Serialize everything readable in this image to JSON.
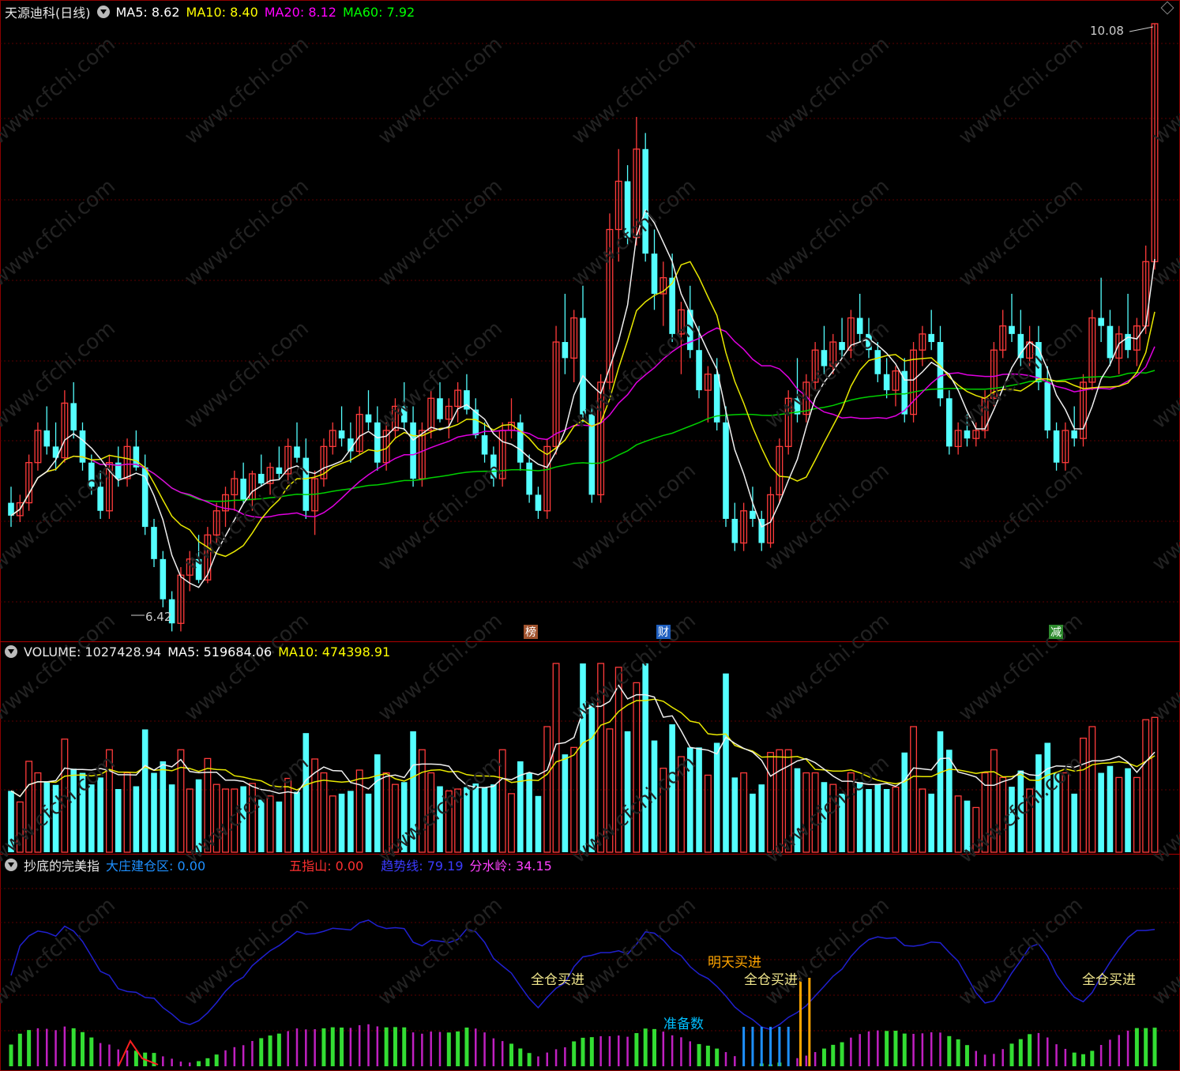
{
  "header": {
    "stock_title": "天源迪科(日线)",
    "ma5_label": "MA5: 8.62",
    "ma10_label": "MA10: 8.40",
    "ma20_label": "MA20: 8.12",
    "ma60_label": "MA60: 7.92",
    "colors": {
      "ma5": "#ffffff",
      "ma10": "#ffff00",
      "ma20": "#ff00ff",
      "ma60": "#00ff00"
    }
  },
  "price_chart": {
    "high_label": "10.08",
    "low_label": "6.42",
    "event_tags": [
      {
        "text": "榜",
        "bg": "#a0522d"
      },
      {
        "text": "财",
        "bg": "#1f5fbf"
      },
      {
        "text": "减",
        "bg": "#2e8b2e"
      }
    ]
  },
  "volume_panel": {
    "volume_label": "VOLUME: 1027428.94",
    "ma5_label": "MA5: 519684.06",
    "ma10_label": "MA10: 474398.91"
  },
  "indicator_panel": {
    "name": "抄底的完美指",
    "dzjc_label": "大庄建仓区: 0.00",
    "wzs_label": "五指山: 0.00",
    "qsx_label": "趋势线: 79.19",
    "fsl_label": "分水岭: 34.15",
    "signals": [
      "全仓买进",
      "准备数",
      "明天买进",
      "全仓买进",
      "全仓买进"
    ]
  },
  "watermark": "www.cfchi.com",
  "chart_data": {
    "type": "candlestick",
    "title": "天源迪科(日线)",
    "price_high": 10.08,
    "price_low": 6.42,
    "ma_latest": {
      "MA5": 8.62,
      "MA10": 8.4,
      "MA20": 8.12,
      "MA60": 7.92
    },
    "volume_latest": {
      "VOLUME": 1027428.94,
      "MA5": 519684.06,
      "MA10": 474398.91
    },
    "indicator_latest": {
      "大庄建仓区": 0.0,
      "五指山": 0.0,
      "趋势线": 79.19,
      "分水岭": 34.15
    },
    "candles_ohlc": [
      [
        7.1,
        7.2,
        6.95,
        7.02
      ],
      [
        7.02,
        7.15,
        6.98,
        7.1
      ],
      [
        7.1,
        7.4,
        7.05,
        7.35
      ],
      [
        7.35,
        7.6,
        7.3,
        7.55
      ],
      [
        7.55,
        7.7,
        7.4,
        7.45
      ],
      [
        7.45,
        7.6,
        7.3,
        7.38
      ],
      [
        7.38,
        7.8,
        7.35,
        7.72
      ],
      [
        7.72,
        7.85,
        7.5,
        7.55
      ],
      [
        7.55,
        7.6,
        7.3,
        7.35
      ],
      [
        7.35,
        7.4,
        7.15,
        7.2
      ],
      [
        7.2,
        7.3,
        7.0,
        7.05
      ],
      [
        7.05,
        7.4,
        7.0,
        7.35
      ],
      [
        7.35,
        7.45,
        7.2,
        7.25
      ],
      [
        7.25,
        7.5,
        7.2,
        7.45
      ],
      [
        7.45,
        7.55,
        7.3,
        7.32
      ],
      [
        7.32,
        7.4,
        6.9,
        6.95
      ],
      [
        6.95,
        7.0,
        6.7,
        6.75
      ],
      [
        6.75,
        6.8,
        6.45,
        6.5
      ],
      [
        6.5,
        6.55,
        6.3,
        6.35
      ],
      [
        6.35,
        6.7,
        6.3,
        6.65
      ],
      [
        6.65,
        6.8,
        6.55,
        6.75
      ],
      [
        6.75,
        6.9,
        6.6,
        6.62
      ],
      [
        6.62,
        6.95,
        6.6,
        6.9
      ],
      [
        6.9,
        7.1,
        6.85,
        7.05
      ],
      [
        7.05,
        7.2,
        6.95,
        7.15
      ],
      [
        7.15,
        7.3,
        7.05,
        7.25
      ],
      [
        7.25,
        7.35,
        7.1,
        7.12
      ],
      [
        7.12,
        7.3,
        7.05,
        7.28
      ],
      [
        7.28,
        7.4,
        7.2,
        7.22
      ],
      [
        7.22,
        7.35,
        7.15,
        7.32
      ],
      [
        7.32,
        7.45,
        7.25,
        7.28
      ],
      [
        7.28,
        7.5,
        7.22,
        7.45
      ],
      [
        7.45,
        7.6,
        7.35,
        7.38
      ],
      [
        7.38,
        7.5,
        7.0,
        7.05
      ],
      [
        7.05,
        7.3,
        6.9,
        7.25
      ],
      [
        7.25,
        7.5,
        7.2,
        7.45
      ],
      [
        7.45,
        7.6,
        7.4,
        7.55
      ],
      [
        7.55,
        7.7,
        7.45,
        7.5
      ],
      [
        7.5,
        7.6,
        7.35,
        7.42
      ],
      [
        7.42,
        7.7,
        7.4,
        7.65
      ],
      [
        7.65,
        7.8,
        7.55,
        7.6
      ],
      [
        7.6,
        7.7,
        7.3,
        7.35
      ],
      [
        7.35,
        7.6,
        7.3,
        7.55
      ],
      [
        7.55,
        7.75,
        7.5,
        7.7
      ],
      [
        7.7,
        7.85,
        7.55,
        7.6
      ],
      [
        7.6,
        7.7,
        7.2,
        7.25
      ],
      [
        7.25,
        7.6,
        7.2,
        7.55
      ],
      [
        7.55,
        7.8,
        7.5,
        7.75
      ],
      [
        7.75,
        7.85,
        7.6,
        7.62
      ],
      [
        7.62,
        7.75,
        7.5,
        7.7
      ],
      [
        7.7,
        7.85,
        7.6,
        7.8
      ],
      [
        7.8,
        7.9,
        7.65,
        7.68
      ],
      [
        7.68,
        7.75,
        7.5,
        7.52
      ],
      [
        7.52,
        7.6,
        7.35,
        7.4
      ],
      [
        7.4,
        7.45,
        7.2,
        7.25
      ],
      [
        7.25,
        7.6,
        7.2,
        7.55
      ],
      [
        7.55,
        7.75,
        7.5,
        7.6
      ],
      [
        7.6,
        7.65,
        7.3,
        7.35
      ],
      [
        7.35,
        7.4,
        7.1,
        7.15
      ],
      [
        7.15,
        7.2,
        7.0,
        7.05
      ],
      [
        7.05,
        7.5,
        7.0,
        7.45
      ],
      [
        7.45,
        8.2,
        7.4,
        8.1
      ],
      [
        8.1,
        8.4,
        7.9,
        8.0
      ],
      [
        8.0,
        8.3,
        7.85,
        8.25
      ],
      [
        8.25,
        8.45,
        7.6,
        7.65
      ],
      [
        7.65,
        7.7,
        7.1,
        7.15
      ],
      [
        7.15,
        7.9,
        7.1,
        7.85
      ],
      [
        7.85,
        8.9,
        7.8,
        8.8
      ],
      [
        8.8,
        9.3,
        8.6,
        9.1
      ],
      [
        9.1,
        9.2,
        8.7,
        8.75
      ],
      [
        8.75,
        9.5,
        8.7,
        9.3
      ],
      [
        9.3,
        9.4,
        8.6,
        8.65
      ],
      [
        8.65,
        8.8,
        8.3,
        8.4
      ],
      [
        8.4,
        8.6,
        8.2,
        8.5
      ],
      [
        8.5,
        8.65,
        8.1,
        8.15
      ],
      [
        8.15,
        8.35,
        7.9,
        8.3
      ],
      [
        8.3,
        8.45,
        8.0,
        8.05
      ],
      [
        8.05,
        8.2,
        7.75,
        7.8
      ],
      [
        7.8,
        7.95,
        7.6,
        7.9
      ],
      [
        7.9,
        8.0,
        7.55,
        7.6
      ],
      [
        7.6,
        7.7,
        6.95,
        7.0
      ],
      [
        7.0,
        7.1,
        6.8,
        6.85
      ],
      [
        6.85,
        7.1,
        6.8,
        7.05
      ],
      [
        7.05,
        7.2,
        6.95,
        7.0
      ],
      [
        7.0,
        7.05,
        6.8,
        6.85
      ],
      [
        6.85,
        7.2,
        6.82,
        7.15
      ],
      [
        7.15,
        7.5,
        7.1,
        7.45
      ],
      [
        7.45,
        7.8,
        7.4,
        7.75
      ],
      [
        7.75,
        8.0,
        7.6,
        7.65
      ],
      [
        7.65,
        7.9,
        7.6,
        7.85
      ],
      [
        7.85,
        8.1,
        7.8,
        8.05
      ],
      [
        8.05,
        8.2,
        7.9,
        7.95
      ],
      [
        7.95,
        8.15,
        7.9,
        8.1
      ],
      [
        8.1,
        8.25,
        8.0,
        8.05
      ],
      [
        8.05,
        8.3,
        8.0,
        8.25
      ],
      [
        8.25,
        8.4,
        8.1,
        8.15
      ],
      [
        8.15,
        8.25,
        8.0,
        8.05
      ],
      [
        8.05,
        8.1,
        7.85,
        7.9
      ],
      [
        7.9,
        8.0,
        7.75,
        7.8
      ],
      [
        7.8,
        7.95,
        7.7,
        7.92
      ],
      [
        7.92,
        8.0,
        7.6,
        7.65
      ],
      [
        7.65,
        8.1,
        7.6,
        8.05
      ],
      [
        8.05,
        8.2,
        7.95,
        8.15
      ],
      [
        8.15,
        8.3,
        8.05,
        8.1
      ],
      [
        8.1,
        8.2,
        7.7,
        7.75
      ],
      [
        7.75,
        7.8,
        7.4,
        7.45
      ],
      [
        7.45,
        7.6,
        7.4,
        7.55
      ],
      [
        7.55,
        7.65,
        7.45,
        7.5
      ],
      [
        7.5,
        7.6,
        7.45,
        7.55
      ],
      [
        7.55,
        7.8,
        7.5,
        7.75
      ],
      [
        7.75,
        8.1,
        7.7,
        8.05
      ],
      [
        8.05,
        8.3,
        8.0,
        8.2
      ],
      [
        8.2,
        8.4,
        8.1,
        8.15
      ],
      [
        8.15,
        8.3,
        7.95,
        8.0
      ],
      [
        8.0,
        8.2,
        7.95,
        8.1
      ],
      [
        8.1,
        8.2,
        7.8,
        7.85
      ],
      [
        7.85,
        7.95,
        7.5,
        7.55
      ],
      [
        7.55,
        7.6,
        7.3,
        7.35
      ],
      [
        7.35,
        7.6,
        7.3,
        7.55
      ],
      [
        7.55,
        7.7,
        7.45,
        7.5
      ],
      [
        7.5,
        7.9,
        7.45,
        7.85
      ],
      [
        7.85,
        8.3,
        7.8,
        8.25
      ],
      [
        8.25,
        8.5,
        8.1,
        8.2
      ],
      [
        8.2,
        8.3,
        7.95,
        8.0
      ],
      [
        8.0,
        8.2,
        7.9,
        8.15
      ],
      [
        8.15,
        8.4,
        8.0,
        8.05
      ],
      [
        8.05,
        8.25,
        7.95,
        8.2
      ],
      [
        8.2,
        8.7,
        8.15,
        8.6
      ],
      [
        8.6,
        10.08,
        8.55,
        10.08
      ]
    ]
  }
}
